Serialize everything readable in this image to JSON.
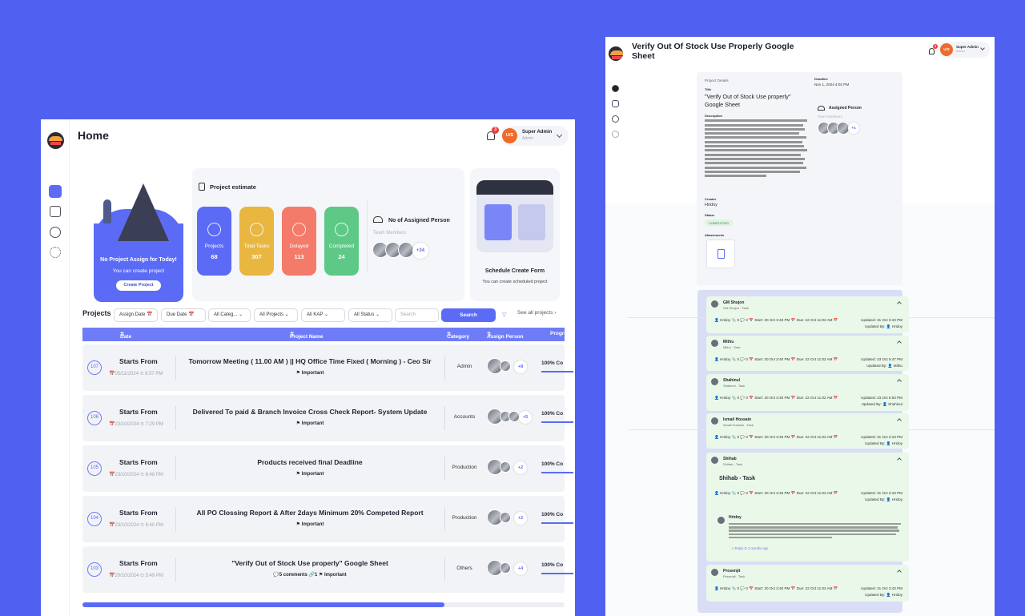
{
  "left_window": {
    "header": {
      "title": "Home",
      "notification_count": "3",
      "user_initials": "U/S",
      "user_name": "Super Admin",
      "user_role": "Admin"
    },
    "hero": {
      "title": "No Project Assign for Today!",
      "subtitle": "You can create project",
      "button": "Create Project"
    },
    "estimate": {
      "title": "Project estimate",
      "stats": [
        {
          "label": "Projects",
          "value": "68",
          "color": "#5b6bf6"
        },
        {
          "label": "Total Tasks",
          "value": "307",
          "color": "#e9b640"
        },
        {
          "label": "Delayed",
          "value": "113",
          "color": "#f47a6a"
        },
        {
          "label": "Completed",
          "value": "24",
          "color": "#5ec986"
        }
      ],
      "assigned_title": "No of Assigned Person",
      "assigned_sub": "Team Members",
      "assigned_more": "+34"
    },
    "schedule": {
      "title": "Schedule Create Form",
      "subtitle": "You can create scheduled project"
    },
    "projects": {
      "title": "Projects",
      "filters": {
        "assign_date": "Assign Date",
        "due_date": "Due Date",
        "category": "All Categ...",
        "projects": "All Projects",
        "kap": "All KAP",
        "status": "All Status",
        "search_placeholder": "Search",
        "search_button": "Search",
        "see_all": "See all projects"
      },
      "columns": {
        "date": "Date",
        "name": "Project Name",
        "category": "Category",
        "assign": "Assign Person",
        "progress": "Progre"
      },
      "rows": [
        {
          "num": "107",
          "starts": "Starts From",
          "date": "05/11/2024  ⏲ 8:57 PM",
          "name": "Tomorrow Meeting ( 11.00 AM ) || HQ Office Time Fixed ( Morning ) - Ceo Sir",
          "tag": "⚑ Important",
          "category": "Admin",
          "more": "+8",
          "progress": "100% Co"
        },
        {
          "num": "106",
          "starts": "Starts From",
          "date": "23/10/2024  ⏲ 7:29 PM",
          "name": "Delivered To paid & Branch Invoice Cross Check Report- System Update",
          "tag": "⚑ Important",
          "category": "Accounts",
          "more": "+5",
          "progress": "100% Co"
        },
        {
          "num": "105",
          "starts": "Starts From",
          "date": "23/10/2024  ⏲ 6:48 PM",
          "name": "Products received final Deadline",
          "tag": "⚑ Important",
          "category": "Production",
          "more": "+2",
          "progress": "100% Co"
        },
        {
          "num": "104",
          "starts": "Starts From",
          "date": "23/10/2024  ⏲ 6:40 PM",
          "name": "All PO Clossing Report & After 2days Minimum 20% Competed Report",
          "tag": "⚑ Important",
          "category": "Production",
          "more": "+2",
          "progress": "100% Co"
        },
        {
          "num": "103",
          "starts": "Starts From",
          "date": "20/10/2024  ⏲ 3:49 PM",
          "name": "\"Verify Out of Stock Use properly\" Google Sheet",
          "tag": "💬5 comments  🔗1  ⚑ Important",
          "category": "Others",
          "more": "+4",
          "progress": "100% Co"
        }
      ],
      "scroll_fraction": 0.75
    }
  },
  "right_window": {
    "header": {
      "title_line1": "Verify Out Of Stock Use Properly Google",
      "title_line2": "Sheet",
      "notification_count": "3",
      "user_initials": "U/S",
      "user_name": "Super Admin",
      "user_role": "Admin"
    },
    "details": {
      "section": "Project Details",
      "title_label": "Title",
      "title_line1": "\"Verify Out of Stock Use properly\"",
      "title_line2": "Google Sheet",
      "deadline_label": "Deadline",
      "deadline": "Nov 1, 2024 4:02 PM",
      "assigned_title": "Assigned Person",
      "assigned_sub": "Team Members",
      "assigned_more": "+4",
      "description_label": "Description",
      "creator_label": "Creator",
      "creator": "Hridoy",
      "status_label": "Status",
      "status": "COMPLETED",
      "attachments_label": "Attachments"
    },
    "tasks": [
      {
        "name": "GM Shujon",
        "sub": "GM Shujon - Task",
        "updated": "Updated: 31 Oct 3:43 PM",
        "by": "Updated By: 👤 Hridoy"
      },
      {
        "name": "Mithu",
        "sub": "Mithu - Task",
        "updated": "Updated: 23 Oct 5:47 PM",
        "by": "Updated By: 👤 Mithu"
      },
      {
        "name": "Shahinul",
        "sub": "Shahinul - Task",
        "updated": "Updated: 23 Oct 5:53 PM",
        "by": "Updated By: 👤 Shahinul"
      },
      {
        "name": "Ismail Hossain",
        "sub": "Ismail Hossain - Task",
        "updated": "Updated: 31 Oct 3:43 PM",
        "by": "Updated By: 👤 Hridoy"
      },
      {
        "name": "Shihab",
        "sub": "Shihab - Task",
        "updated": "Updated: 31 Oct 3:43 PM",
        "by": "Updated By: 👤 Hridoy",
        "body": "Shihab - Task",
        "comment_author": "Hridoy",
        "comment_actions": "⏎ Reply  ⏲ 2 months ago"
      },
      {
        "name": "Prosenjit",
        "sub": "Prosenjit - Task",
        "updated": "Updated: 31 Oct 3:43 PM",
        "by": "Updated By: 👤 Hridoy"
      }
    ],
    "task_meta": "👤 Hridoy   📎 0   💬 0   📅 Start: 20 Oct 3:40 PM   📅 Due: 22 Oct 11:02 AM   📅"
  }
}
